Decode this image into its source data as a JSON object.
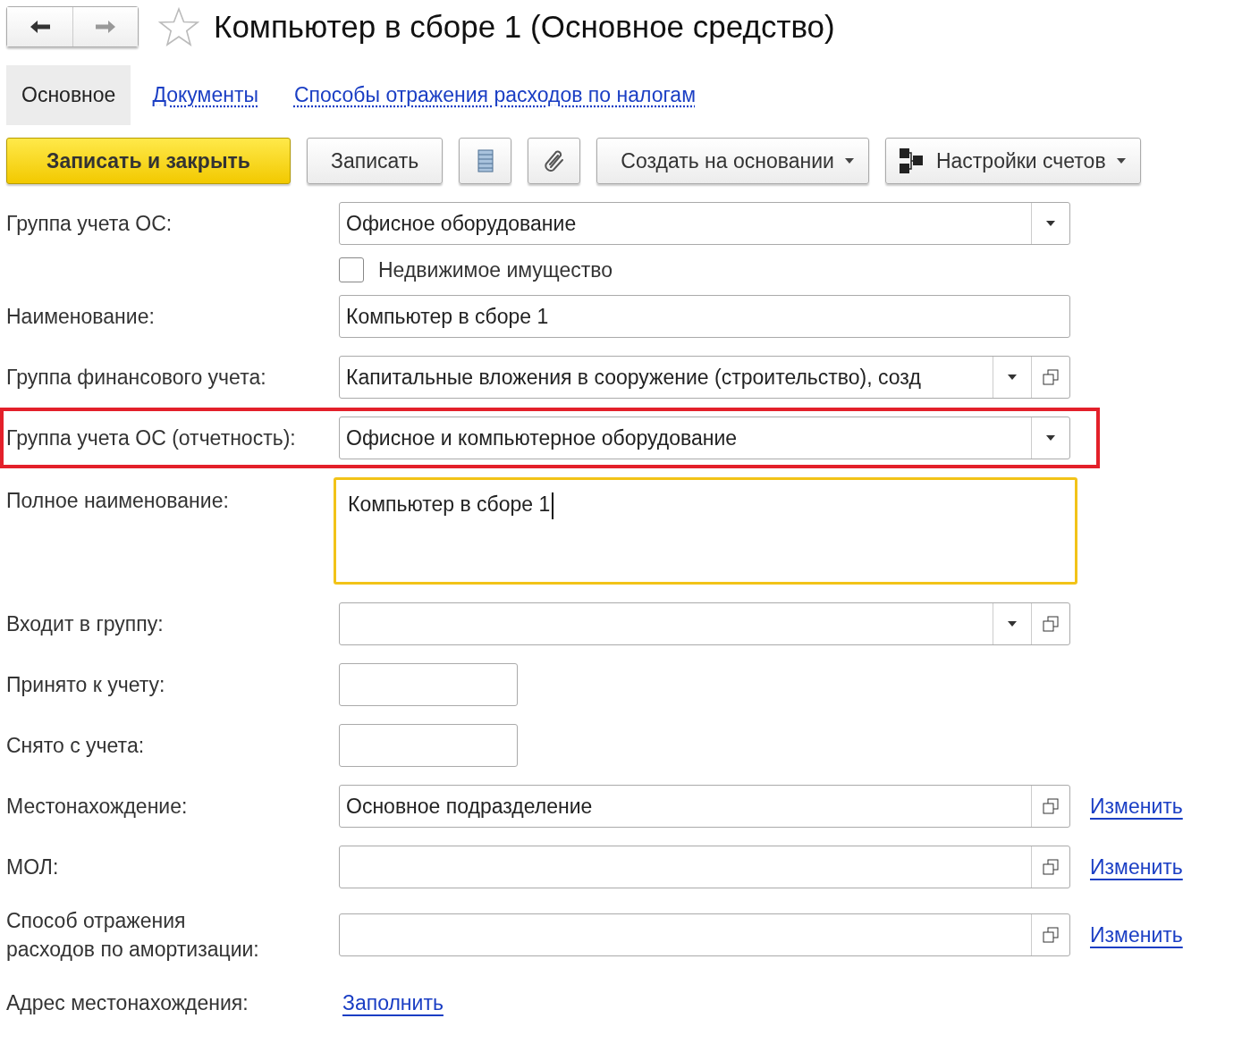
{
  "title": "Компьютер в сборе 1 (Основное средство)",
  "tabs": [
    {
      "label": "Основное",
      "selected": true
    },
    {
      "label": "Документы",
      "selected": false
    },
    {
      "label": "Способы отражения расходов по налогам",
      "selected": false
    }
  ],
  "toolbar": [
    {
      "kind": "primary",
      "label": "Записать и закрыть"
    },
    {
      "kind": "plain",
      "label": "Записать"
    },
    {
      "kind": "list_icon"
    },
    {
      "kind": "clip_icon"
    },
    {
      "kind": "menu",
      "label": "Создать на основании"
    },
    {
      "kind": "menu_scheme",
      "label": "Настройки счетов"
    }
  ],
  "fields": [
    {
      "kind": "select",
      "label": "Группа учета ОС:",
      "value": "Офисное оборудование",
      "highlighted": false
    },
    {
      "kind": "checkbox",
      "label": "Недвижимое имущество",
      "checked": false
    },
    {
      "kind": "text",
      "label": "Наименование:",
      "value": "Компьютер в сборе 1"
    },
    {
      "kind": "select_open",
      "label": "Группа финансового учета:",
      "value": "Капитальные вложения в сооружение (строительство), созд"
    },
    {
      "kind": "select",
      "label": "Группа учета ОС (отчетность):",
      "value": "Офисное и компьютерное оборудование",
      "highlighted": true
    },
    {
      "kind": "textarea",
      "label": "Полное наименование:",
      "value": "Компьютер в сборе 1",
      "focused": true
    },
    {
      "kind": "select_open",
      "label": "Входит в группу:"
    },
    {
      "kind": "date",
      "label": "Принято к учету:"
    },
    {
      "kind": "date",
      "label": "Снято с учета:"
    },
    {
      "kind": "open",
      "label": "Местонахождение:",
      "value": "Основное подразделение",
      "link": "Изменить"
    },
    {
      "kind": "open",
      "label": "МОЛ:",
      "link": "Изменить"
    },
    {
      "kind": "open",
      "label": "Способ отражения\nрасходов по амортизации:",
      "link": "Изменить"
    },
    {
      "kind": "link",
      "label": "Адрес местонахождения:",
      "link": "Заполнить"
    }
  ]
}
